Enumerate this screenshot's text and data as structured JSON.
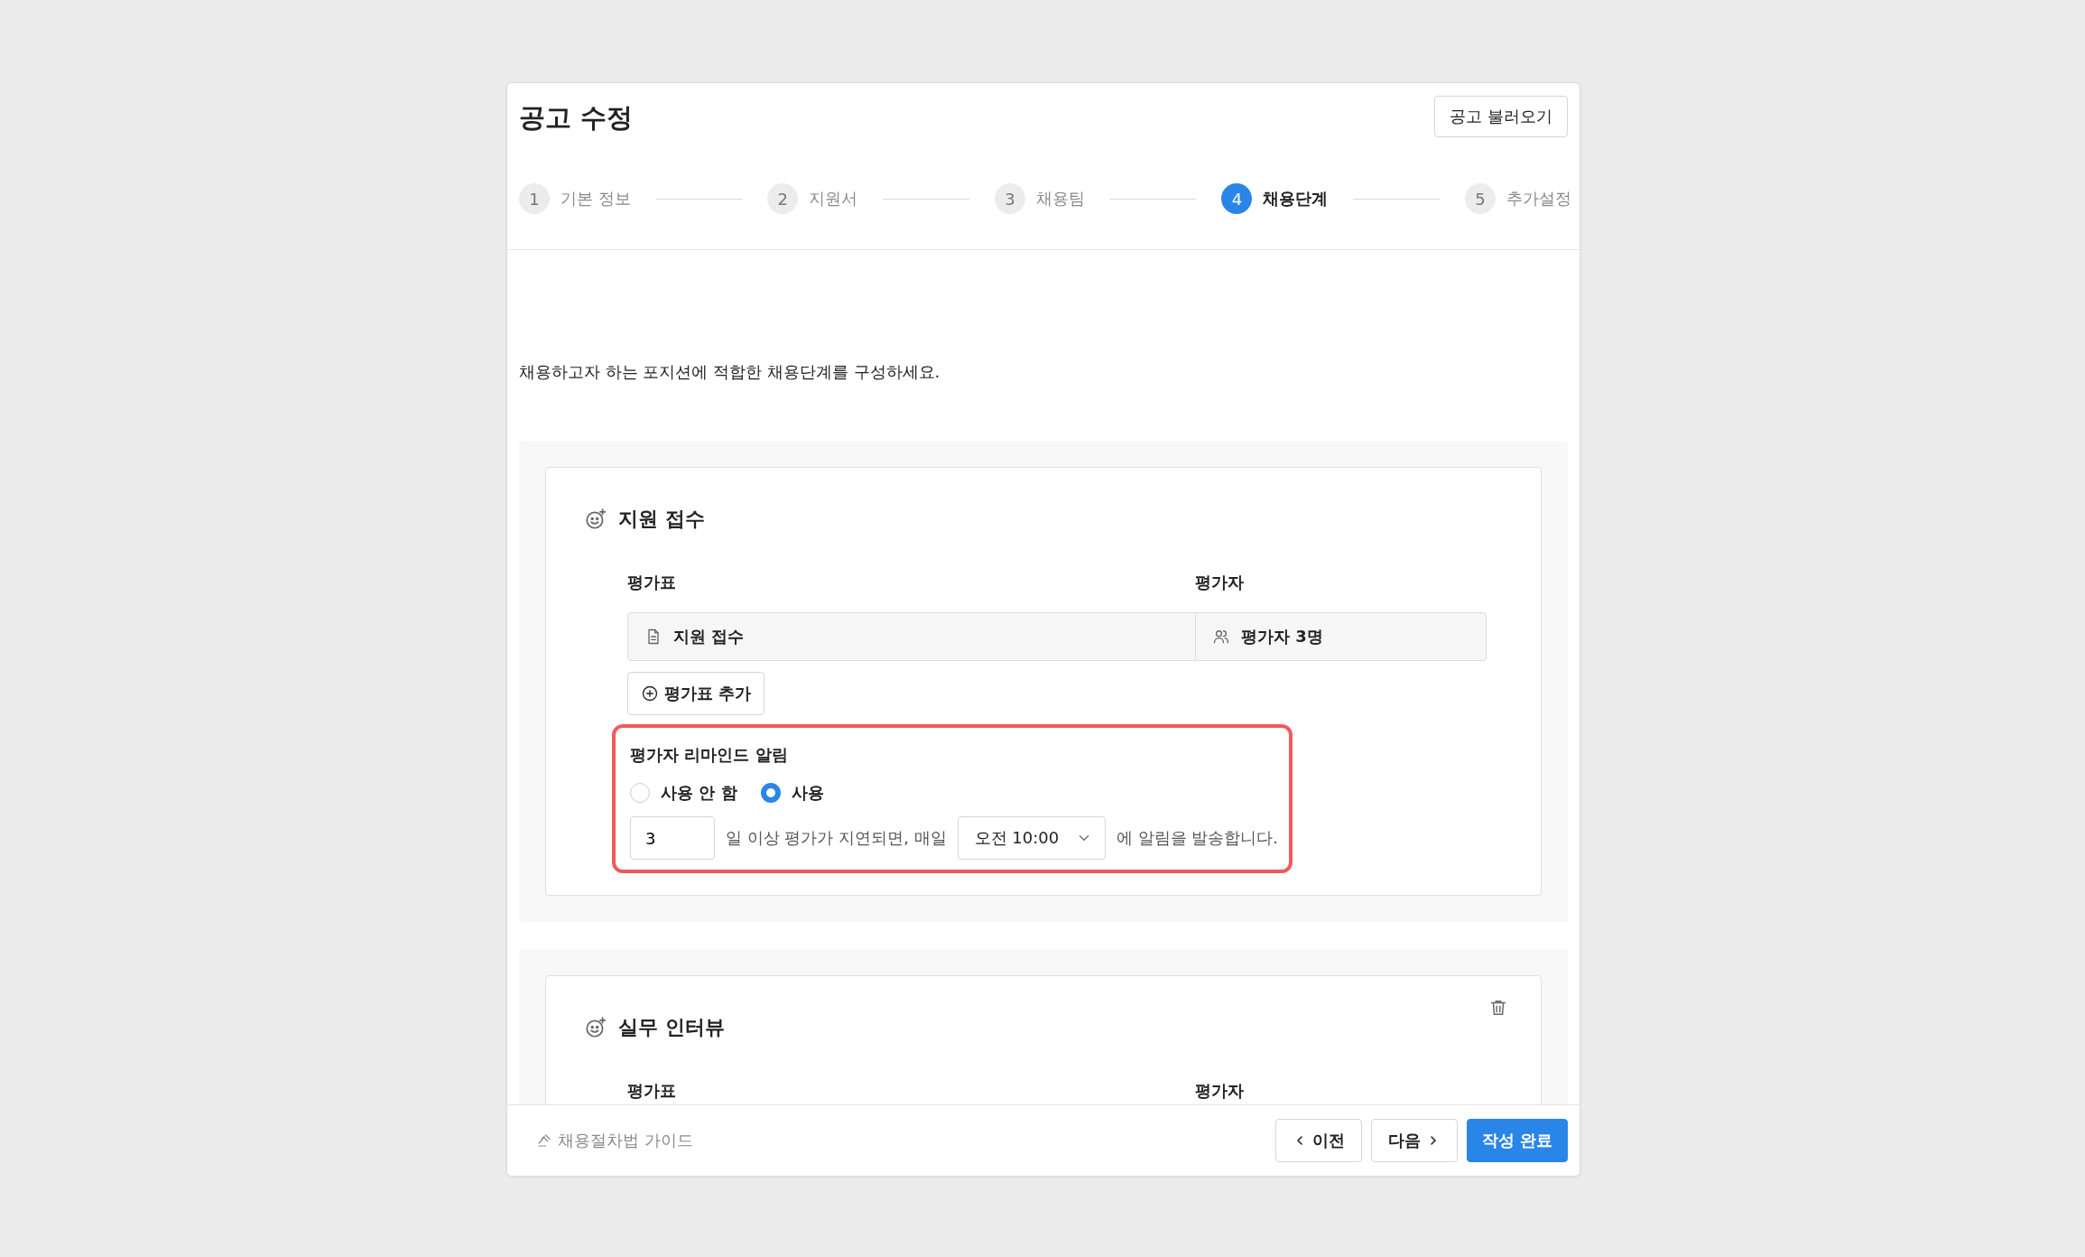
{
  "modal": {
    "title": "공고 수정",
    "load_button": "공고 불러오기"
  },
  "steps": [
    {
      "number": "1",
      "label": "기본 정보",
      "selected": false
    },
    {
      "number": "2",
      "label": "지원서",
      "selected": false
    },
    {
      "number": "3",
      "label": "채용팀",
      "selected": false
    },
    {
      "number": "4",
      "label": "채용단계",
      "selected": true
    },
    {
      "number": "5",
      "label": "추가설정",
      "selected": false
    }
  ],
  "intro": "채용하고자 하는 포지션에 적합한 채용단계를 구성하세요.",
  "stages": [
    {
      "title": "지원 접수",
      "deletable": false,
      "columns": [
        "평가표",
        "평가자"
      ],
      "rows": [
        {
          "sheet": "지원 접수",
          "evaluators": "평가자 3명"
        }
      ],
      "add_button": "평가표 추가",
      "reminder": {
        "label": "평가자 리마인드 알림",
        "highlighted": true,
        "options": [
          {
            "label": "사용 안 함",
            "selected": false
          },
          {
            "label": "사용",
            "selected": true
          }
        ],
        "days": "3",
        "text_before": "일 이상 평가가 지연되면, 매일",
        "time": "오전 10:00",
        "text_after": "에 알림을 발송합니다."
      }
    },
    {
      "title": "실무 인터뷰",
      "deletable": true,
      "columns": [
        "평가표",
        "평가자"
      ]
    }
  ],
  "footer": {
    "guide_link": "채용절차법 가이드",
    "prev_button": "이전",
    "next_button": "다음",
    "submit_button": "작성 완료"
  }
}
